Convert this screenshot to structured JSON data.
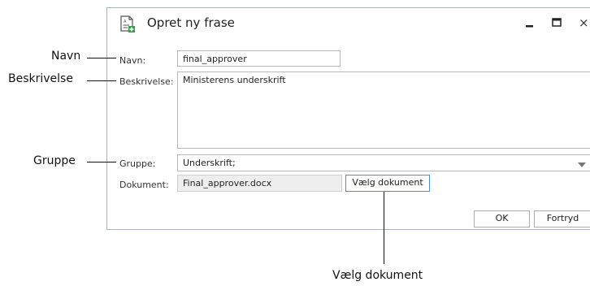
{
  "window": {
    "title": "Opret ny frase",
    "close_glyph": "×"
  },
  "form": {
    "navn_label": "Navn:",
    "navn_value": "final_approver",
    "beskrivelse_label": "Beskrivelse:",
    "beskrivelse_value": "Ministerens underskrift",
    "gruppe_label": "Gruppe:",
    "gruppe_value": "Underskrift;",
    "dokument_label": "Dokument:",
    "dokument_value": "Final_approver.docx",
    "vaelg_button": "Vælg dokument",
    "ok_button": "OK",
    "fortryd_button": "Fortryd"
  },
  "callouts": {
    "navn": "Navn",
    "beskrivelse": "Beskrivelse",
    "gruppe": "Gruppe",
    "vaelg": "Vælg dokument"
  },
  "icons": {
    "title": "document-add-icon",
    "dropdown": "chevron-down-icon"
  },
  "colors": {
    "accent": "#4a90d9",
    "icon_green": "#3a9b4a"
  }
}
